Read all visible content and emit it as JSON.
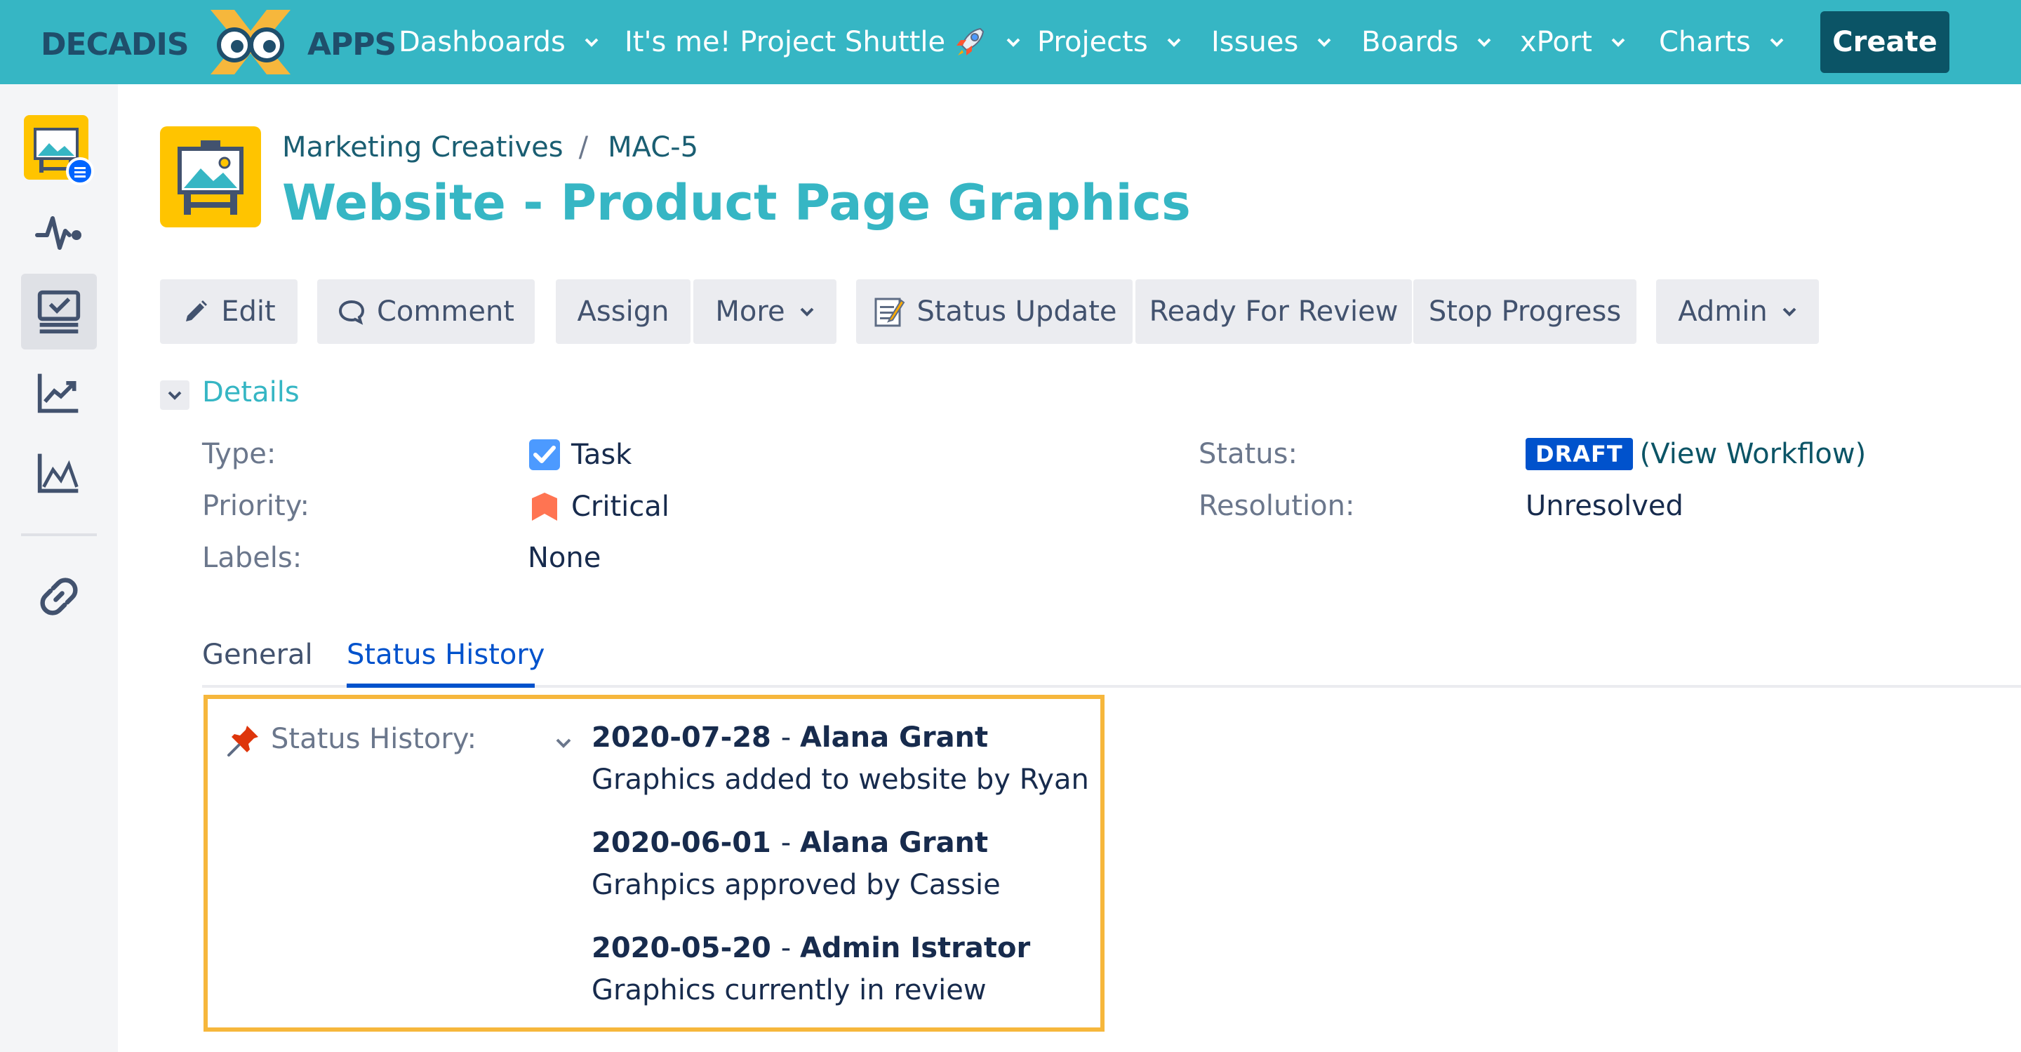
{
  "logo": {
    "left_word": "DECADIS",
    "right_word": "APPS"
  },
  "nav": {
    "items": [
      {
        "label": "Dashboards"
      },
      {
        "label": "It's me! Project Shuttle"
      },
      {
        "label": "Projects"
      },
      {
        "label": "Issues"
      },
      {
        "label": "Boards"
      },
      {
        "label": "xPort"
      },
      {
        "label": "Charts"
      }
    ],
    "create_label": "Create"
  },
  "sidebar": {
    "icons": [
      "project-avatar-icon",
      "activity-icon",
      "board-icon",
      "reports-icon",
      "chart-icon",
      "link-icon"
    ]
  },
  "breadcrumb": {
    "project": "Marketing Creatives",
    "separator": "/",
    "issue_key": "MAC-5"
  },
  "issue": {
    "title": "Website - Product Page Graphics"
  },
  "toolbar": {
    "edit": "Edit",
    "comment": "Comment",
    "assign": "Assign",
    "more": "More",
    "status_update": "Status Update",
    "ready_for_review": "Ready For Review",
    "stop_progress": "Stop Progress",
    "admin": "Admin"
  },
  "details": {
    "title": "Details",
    "type_label": "Type:",
    "type_value": "Task",
    "priority_label": "Priority:",
    "priority_value": "Critical",
    "labels_label": "Labels:",
    "labels_value": "None",
    "status_label": "Status:",
    "status_value": "DRAFT",
    "status_link": "(View Workflow)",
    "resolution_label": "Resolution:",
    "resolution_value": "Unresolved"
  },
  "tabs": {
    "general": "General",
    "status_history": "Status History"
  },
  "history": {
    "label": "Status History:",
    "entries": [
      {
        "date": "2020-07-28",
        "user": "Alana Grant",
        "text": "Graphics added to website by Ryan"
      },
      {
        "date": "2020-06-01",
        "user": "Alana Grant",
        "text": "Grahpics approved by Cassie"
      },
      {
        "date": "2020-05-20",
        "user": "Admin Istrator",
        "text": "Graphics currently in review"
      }
    ]
  },
  "colors": {
    "nav_bg": "#36b6c4",
    "create_bg": "#0b5466",
    "title": "#36b6c4",
    "draft_badge": "#0052cc",
    "highlight_border": "#f6b73c",
    "priority_critical": "#ff7452"
  }
}
